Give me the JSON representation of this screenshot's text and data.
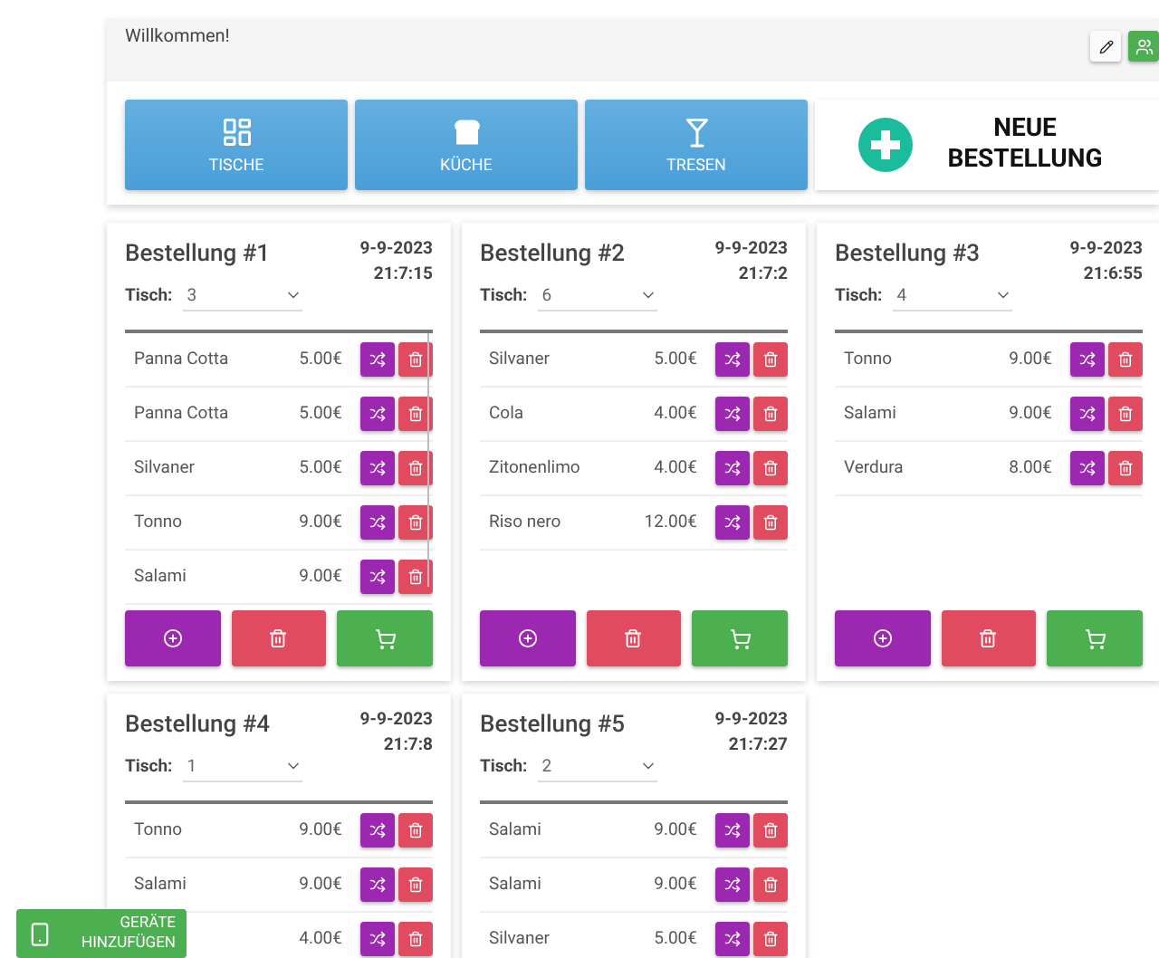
{
  "header": {
    "greeting": "Willkommen!"
  },
  "nav": [
    {
      "kind": "tables",
      "label": "TISCHE"
    },
    {
      "kind": "kitchen",
      "label": "KÜCHE"
    },
    {
      "kind": "bar",
      "label": "TRESEN"
    }
  ],
  "new_order": {
    "label": "NEUE BESTELLUNG"
  },
  "orders": [
    {
      "title": "Bestellung #1",
      "date": "9-9-2023",
      "time": "21:7:15",
      "table_label": "Tisch:",
      "table_value": "3",
      "items": [
        {
          "name": "Panna Cotta",
          "price": "5.00€"
        },
        {
          "name": "Panna Cotta",
          "price": "5.00€"
        },
        {
          "name": "Silvaner",
          "price": "5.00€"
        },
        {
          "name": "Tonno",
          "price": "9.00€"
        },
        {
          "name": "Salami",
          "price": "9.00€"
        }
      ]
    },
    {
      "title": "Bestellung #2",
      "date": "9-9-2023",
      "time": "21:7:2",
      "table_label": "Tisch:",
      "table_value": "6",
      "items": [
        {
          "name": "Silvaner",
          "price": "5.00€"
        },
        {
          "name": "Cola",
          "price": "4.00€"
        },
        {
          "name": "Zitonenlimo",
          "price": "4.00€"
        },
        {
          "name": "Riso nero",
          "price": "12.00€"
        }
      ]
    },
    {
      "title": "Bestellung #3",
      "date": "9-9-2023",
      "time": "21:6:55",
      "table_label": "Tisch:",
      "table_value": "4",
      "items": [
        {
          "name": "Tonno",
          "price": "9.00€"
        },
        {
          "name": "Salami",
          "price": "9.00€"
        },
        {
          "name": "Verdura",
          "price": "8.00€"
        }
      ]
    },
    {
      "title": "Bestellung #4",
      "date": "9-9-2023",
      "time": "21:7:8",
      "table_label": "Tisch:",
      "table_value": "1",
      "items": [
        {
          "name": "Tonno",
          "price": "9.00€"
        },
        {
          "name": "Salami",
          "price": "9.00€"
        },
        {
          "price": "4.00€"
        }
      ]
    },
    {
      "title": "Bestellung #5",
      "date": "9-9-2023",
      "time": "21:7:27",
      "table_label": "Tisch:",
      "table_value": "2",
      "items": [
        {
          "name": "Salami",
          "price": "9.00€"
        },
        {
          "name": "Salami",
          "price": "9.00€"
        },
        {
          "name": "Silvaner",
          "price": "5.00€"
        }
      ]
    }
  ],
  "add_devices_button": "GERÄTE HINZUFÜGEN"
}
